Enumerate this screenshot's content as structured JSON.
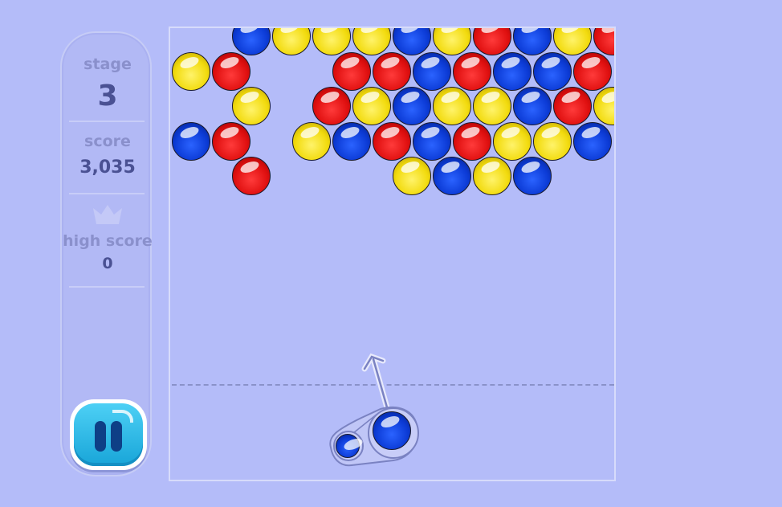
{
  "sidebar": {
    "stage_label": "stage",
    "stage_value": "3",
    "score_label": "score",
    "score_value": "3,035",
    "high_score_label": "high score",
    "high_score_value": "0",
    "pause_icon": "pause-icon",
    "crown_icon": "crown-icon"
  },
  "colors": {
    "background": "#b4bcf9",
    "red": "#e01010",
    "blue": "#0c3bd6",
    "yellow": "#f2db0e",
    "pause_button": "#18a5d8"
  },
  "grid": {
    "rows": [
      [
        "",
        "blue",
        "yellow",
        "yellow",
        "yellow",
        "blue",
        "yellow",
        "red",
        "blue",
        "yellow",
        "red"
      ],
      [
        "yellow",
        "red",
        "",
        "",
        "red",
        "red",
        "blue",
        "red",
        "blue",
        "blue",
        "red"
      ],
      [
        "",
        "yellow",
        "",
        "red",
        "yellow",
        "blue",
        "yellow",
        "yellow",
        "blue",
        "red",
        "yellow"
      ],
      [
        "blue",
        "red",
        "",
        "yellow",
        "blue",
        "red",
        "blue",
        "red",
        "yellow",
        "yellow",
        "blue"
      ],
      [
        "",
        "red",
        "",
        "",
        "",
        "yellow",
        "blue",
        "yellow",
        "blue",
        "",
        ""
      ]
    ]
  },
  "shooter": {
    "current_bubble": "blue",
    "next_bubble": "blue"
  }
}
